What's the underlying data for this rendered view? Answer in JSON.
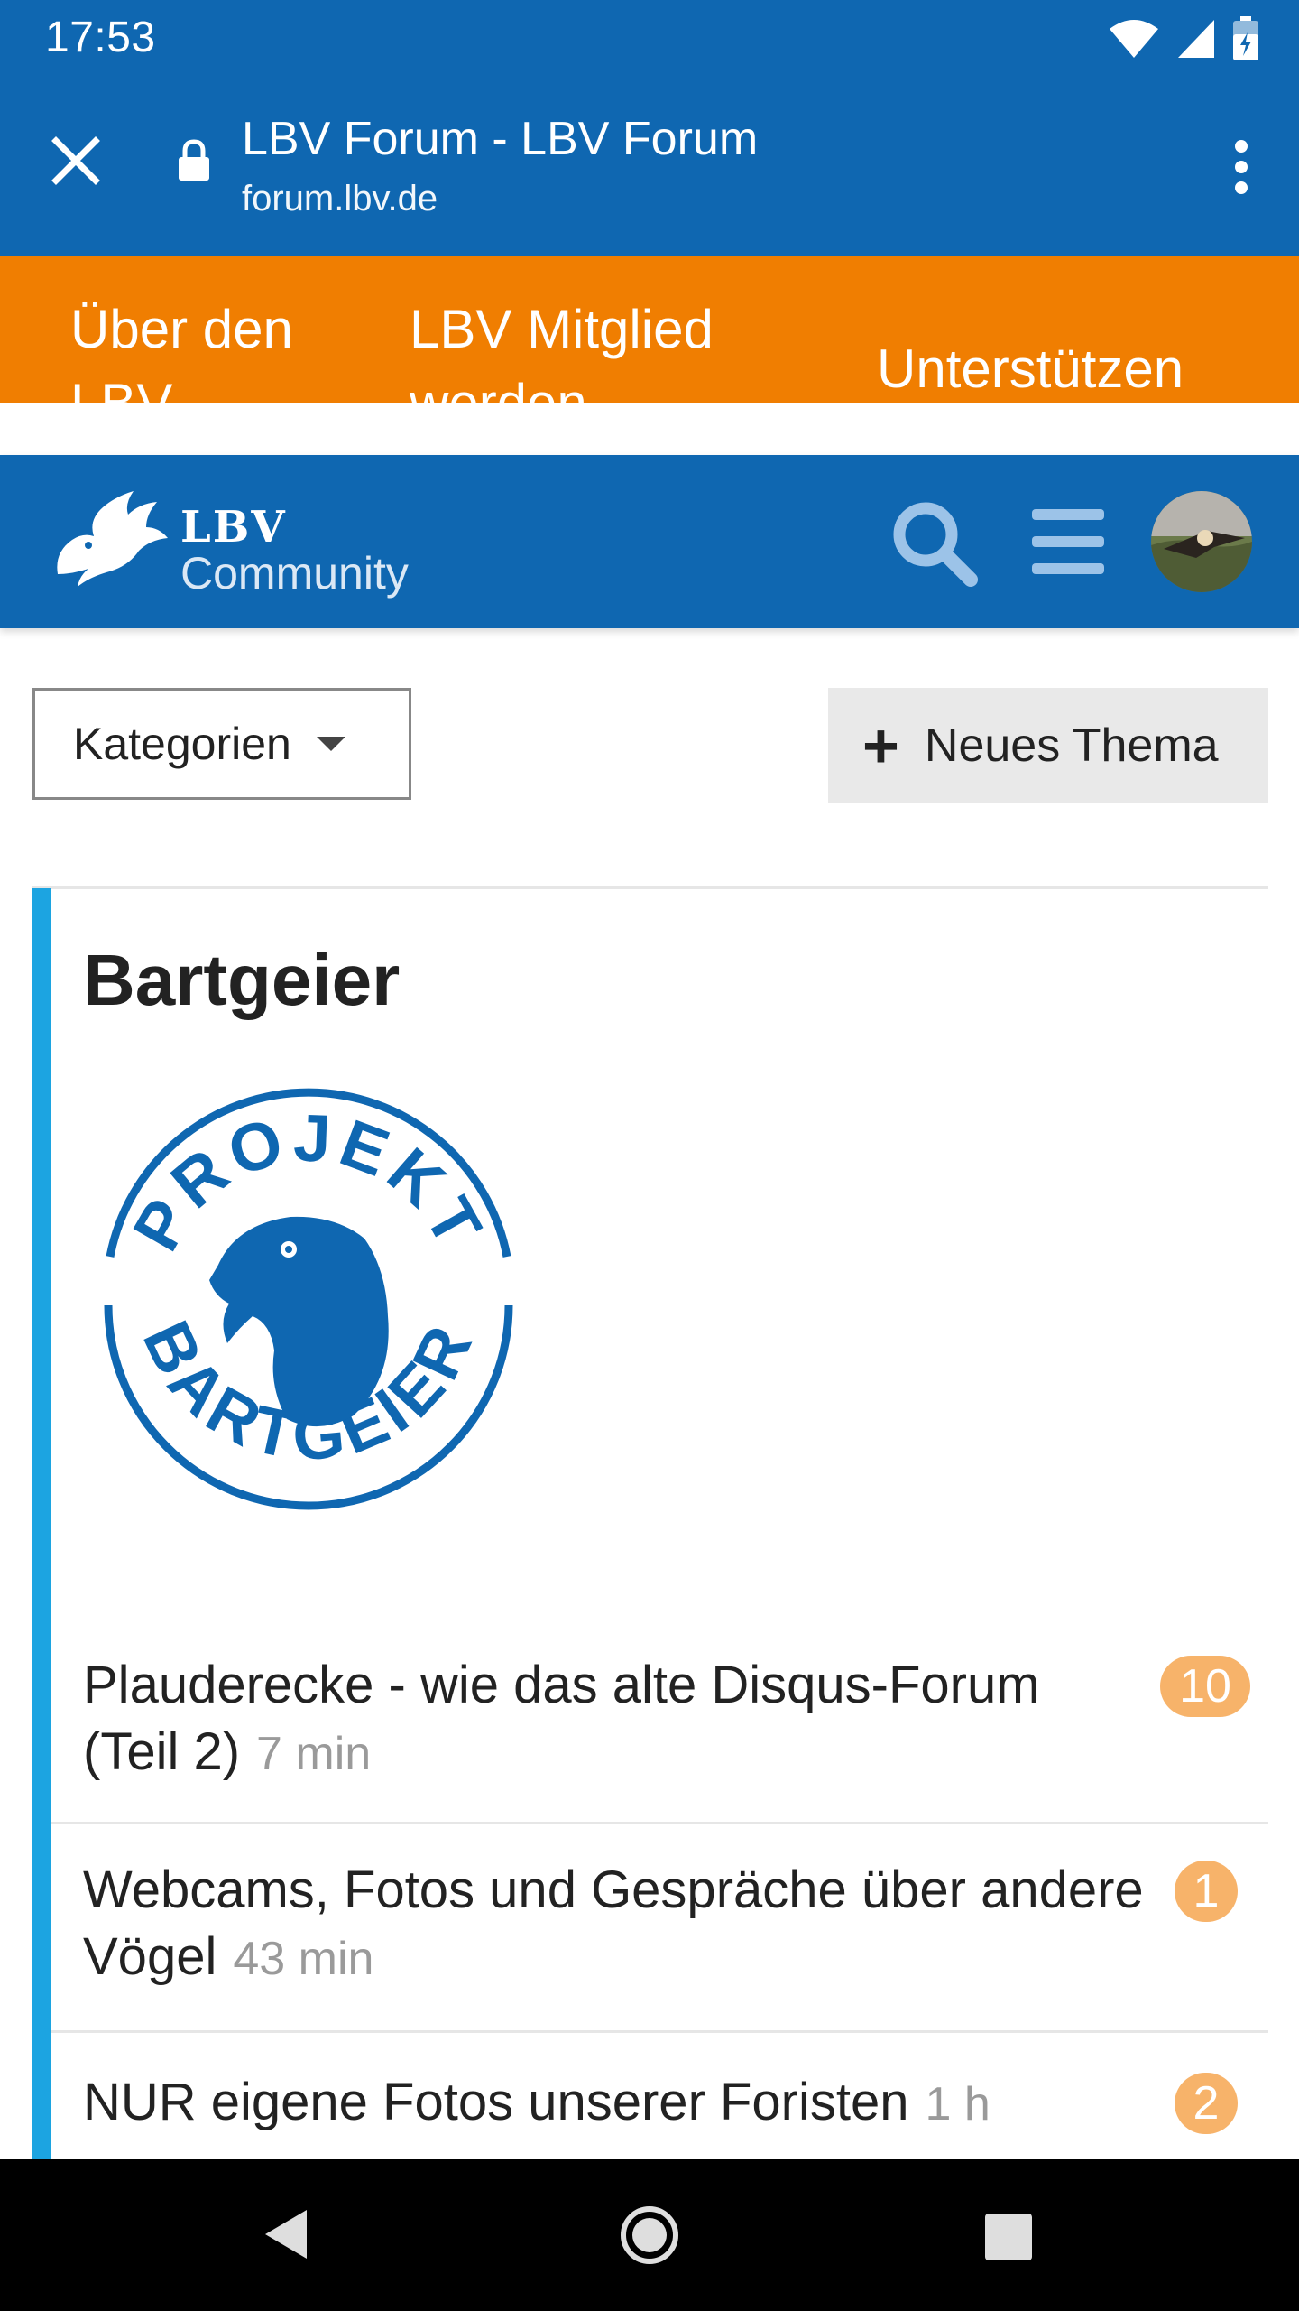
{
  "status_bar": {
    "time": "17:53"
  },
  "browser": {
    "page_title": "LBV Forum - LBV Forum",
    "url": "forum.lbv.de"
  },
  "orange_nav": {
    "items": [
      {
        "label": "Über den LBV"
      },
      {
        "label": "LBV Mitglied werden"
      },
      {
        "label": "Unterstützen"
      }
    ]
  },
  "community_header": {
    "brand_line1": "LBV",
    "brand_line2": "Community"
  },
  "actions": {
    "categories_label": "Kategorien",
    "new_topic_label": "Neues Thema"
  },
  "category": {
    "title": "Bartgeier",
    "logo_text_top": "PROJEKT",
    "logo_text_bottom": "BARTGEIER",
    "accent_color": "#1ca4e1"
  },
  "topics": [
    {
      "title": "Plauderecke - wie das alte Disqus-Forum (Teil 2)",
      "age": "7 min",
      "count": "10"
    },
    {
      "title": "Webcams, Fotos und Gespräche über andere Vögel",
      "age": "43 min",
      "count": "1"
    },
    {
      "title": "NUR eigene Fotos unserer Foristen",
      "age": "1 h",
      "count": "2"
    }
  ],
  "colors": {
    "primary_blue": "#0f67b1",
    "orange": "#f07e01",
    "badge": "#f7b36a"
  }
}
